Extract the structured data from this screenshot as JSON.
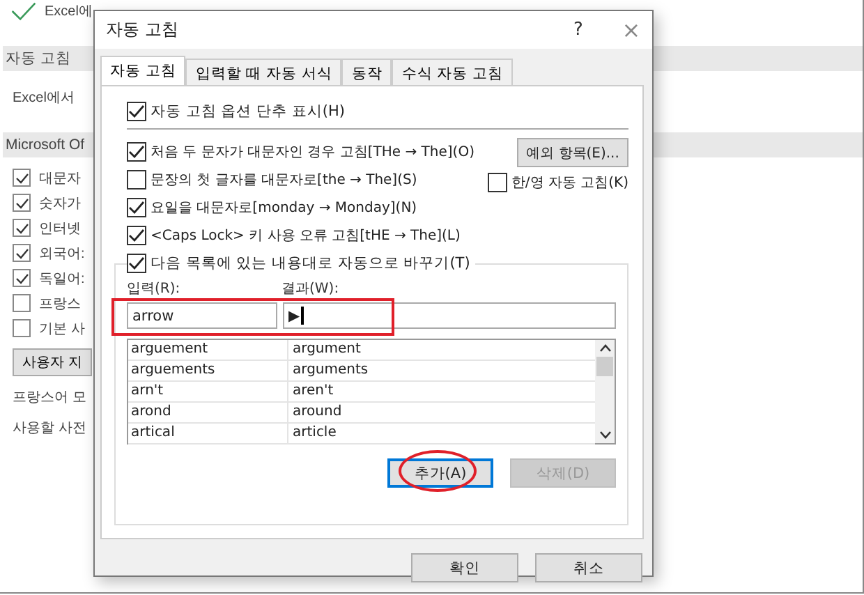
{
  "background": {
    "intro": "Excel에",
    "section_title": "자동 고침",
    "description": "Excel에서",
    "office_section": "Microsoft Of",
    "options": [
      {
        "label": "대문자",
        "checked": true
      },
      {
        "label": "숫자가",
        "checked": true
      },
      {
        "label": "인터넷",
        "checked": true
      },
      {
        "label": "외국어:",
        "checked": true
      },
      {
        "label": "독일어:",
        "checked": true
      },
      {
        "label": "프랑스",
        "checked": false
      },
      {
        "label": "기본 사",
        "checked": false
      }
    ],
    "custom_button": "사용자 지",
    "french_text": "프랑스어 모",
    "dictionary_text": "사용할 사전"
  },
  "dialog": {
    "title": "자동 고침",
    "help": "?",
    "close": "×",
    "tabs": [
      {
        "label": "자동 고침",
        "selected": true
      },
      {
        "label": "입력할 때 자동 서식",
        "selected": false
      },
      {
        "label": "동작",
        "selected": false
      },
      {
        "label": "수식 자동 고침",
        "selected": false
      }
    ],
    "show_buttons": {
      "label": "자동 고침 옵션 단추 표시(H)",
      "checked": true
    },
    "rules": [
      {
        "label": "처음 두 문자가 대문자인 경우 고침[THe → The](O)",
        "checked": true
      },
      {
        "label": "문장의 첫 글자를 대문자로[the → The](S)",
        "checked": false
      },
      {
        "label": "요일을 대문자로[monday → Monday](N)",
        "checked": true
      },
      {
        "label": "<Caps Lock> 키 사용 오류 고침[tHE → The](L)",
        "checked": true
      }
    ],
    "exceptions_button": "예외 항목(E)...",
    "hanyoung": {
      "label": "한/영 자동 고침(K)",
      "checked": false
    },
    "replace": {
      "label": "다음 목록에 있는 내용대로 자동으로 바꾸기(T)",
      "checked": true
    },
    "replace_label": "입력(R):",
    "with_label": "결과(W):",
    "replace_value": "arrow",
    "with_value": "▶",
    "entries": [
      {
        "replace": "arguement",
        "with": "argument"
      },
      {
        "replace": "arguements",
        "with": "arguments"
      },
      {
        "replace": "arn't",
        "with": "aren't"
      },
      {
        "replace": "arond",
        "with": "around"
      },
      {
        "replace": "artical",
        "with": "article"
      }
    ],
    "add_button": {
      "label": "추가(A)",
      "disabled": false
    },
    "delete_button": {
      "label": "삭제(D)",
      "disabled": true
    },
    "ok": "확인",
    "cancel": "취소"
  }
}
